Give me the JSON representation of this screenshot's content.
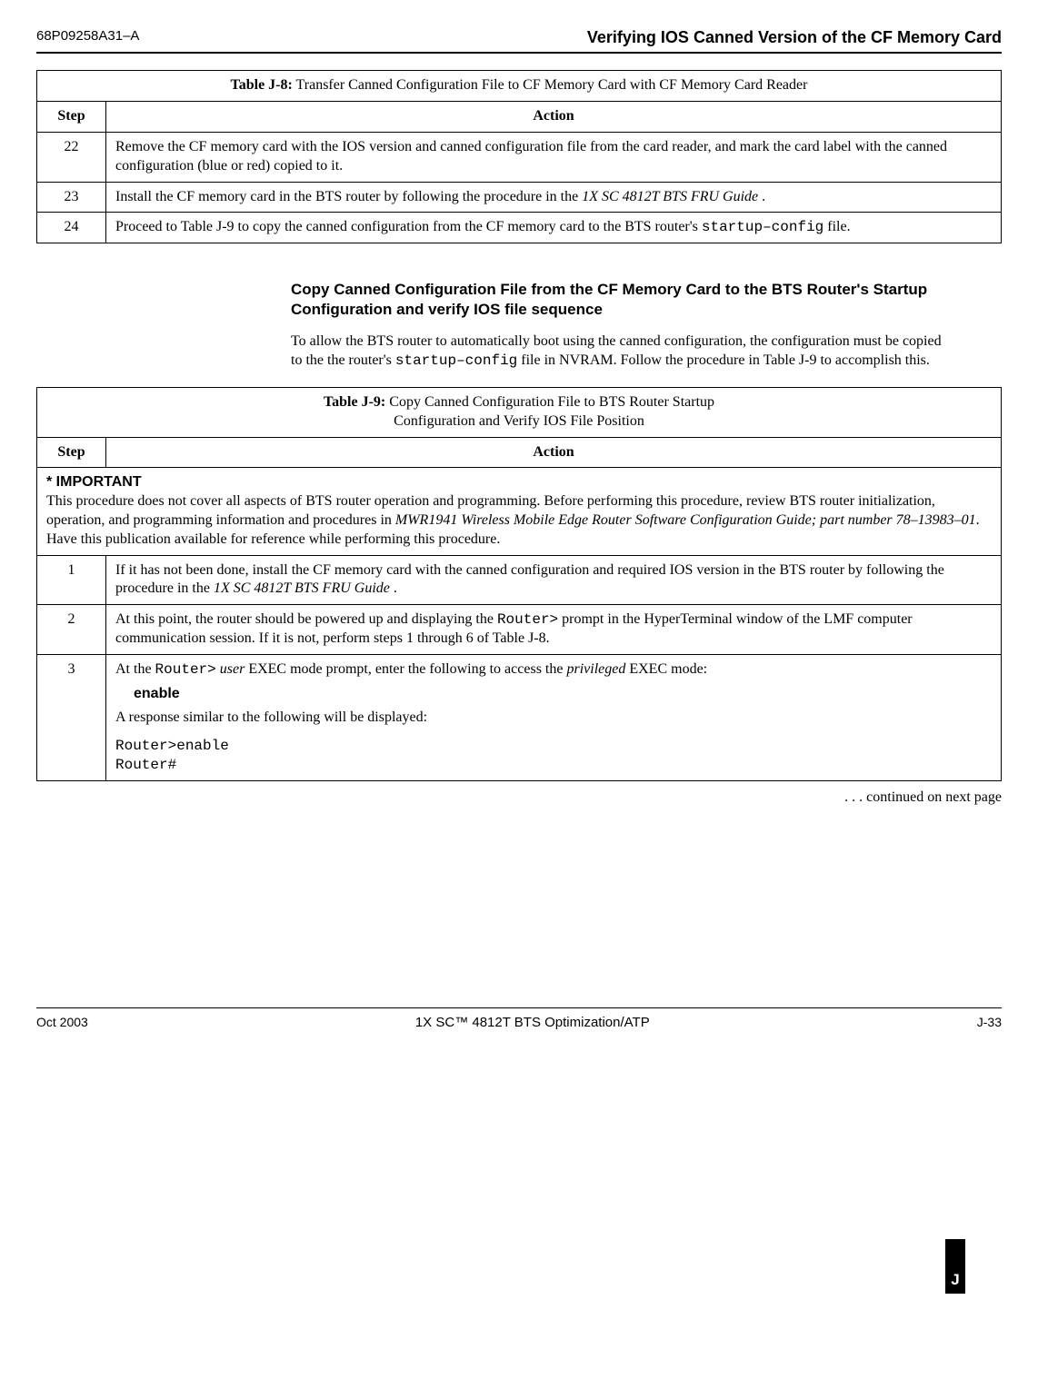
{
  "header": {
    "doc_id": "68P09258A31–A",
    "doc_title": "Verifying IOS Canned Version of the CF Memory Card"
  },
  "table_j8": {
    "title_label": "Table J-8:",
    "title_rest": " Transfer Canned Configuration File to CF Memory Card with CF Memory Card Reader",
    "step_head": "Step",
    "action_head": "Action",
    "rows": [
      {
        "step": "22",
        "action": "Remove the CF memory card with the IOS version and canned configuration file from the card reader, and mark the card label with the canned configuration (blue or red) copied to it."
      },
      {
        "step": "23",
        "action_pre": "Install the CF memory card in the BTS router by following the procedure in the ",
        "action_em": "1X SC 4812T BTS FRU Guide ",
        "action_post": "."
      },
      {
        "step": "24",
        "action_pre": "Proceed to Table J-9 to copy the canned configuration from the CF memory card to the BTS router's ",
        "action_code": "startup–config",
        "action_post": " file."
      }
    ]
  },
  "section": {
    "heading": "Copy Canned Configuration File from the CF Memory Card to the BTS Router's Startup Configuration and verify IOS file sequence",
    "body_pre": " To allow the BTS router to automatically boot using the canned configuration, the configuration must be copied to the the router's ",
    "body_code": "startup–config",
    "body_post": " file in NVRAM. Follow the procedure in Table J-9 to accomplish this."
  },
  "table_j9": {
    "title_label": "Table J-9:",
    "title_line1": " Copy Canned Configuration File to BTS Router Startup",
    "title_line2": "Configuration and Verify IOS File Position",
    "step_head": "Step",
    "action_head": "Action",
    "important_label": "* IMPORTANT",
    "important_body_pre": "This procedure does not cover all aspects of BTS router operation and programming. Before performing this procedure, review BTS router initialization, operation, and programming information and procedures in ",
    "important_body_em": "MWR1941 Wireless Mobile Edge Router Software Configuration Guide; part number 78–13983–01",
    "important_body_post": ". Have this publication available for reference while performing this procedure.",
    "rows": [
      {
        "step": "1",
        "action_pre": "If it has not been done, install the CF memory card with the canned configuration and required IOS version in the BTS router by following the procedure in the ",
        "action_em": "1X SC 4812T BTS FRU Guide ",
        "action_post": "."
      },
      {
        "step": "2",
        "action_pre": "At this point, the router should be powered up and displaying the ",
        "action_code": "Router>",
        "action_mid": " prompt in the HyperTerminal window of the LMF computer communication session. If it is not, perform steps 1 through 6 of Table J-8."
      },
      {
        "step": "3",
        "action_l1_pre": "At the ",
        "action_l1_code": "Router>",
        "action_l1_mid": " ",
        "action_l1_em": "user",
        "action_l1_mid2": " EXEC mode prompt, enter the following to access the ",
        "action_l1_em2": "privileged",
        "action_l1_post": " EXEC mode:",
        "action_cmd": "enable",
        "action_resp_intro": "A response similar to the following will be displayed:",
        "action_resp_code1": "Router>enable",
        "action_resp_code2": "Router#"
      }
    ]
  },
  "continued": ". . . continued on next page",
  "footer": {
    "left": "Oct 2003",
    "center": "1X SC™ 4812T BTS Optimization/ATP",
    "right": "J-33",
    "appendix": "J"
  }
}
